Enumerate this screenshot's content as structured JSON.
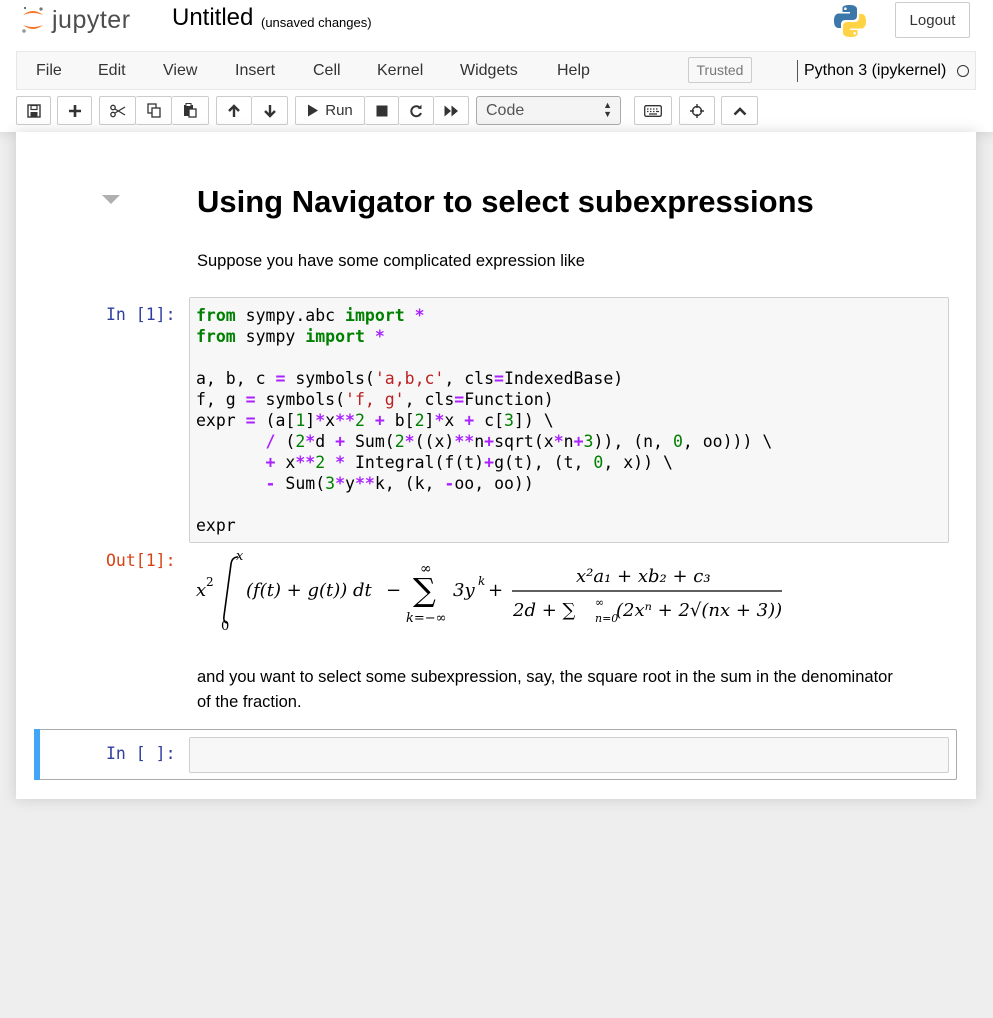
{
  "header": {
    "logo_text": "jupyter",
    "notebook_name": "Untitled",
    "save_status": "(unsaved changes)",
    "logout_label": "Logout"
  },
  "menubar": {
    "items": [
      "File",
      "Edit",
      "View",
      "Insert",
      "Cell",
      "Kernel",
      "Widgets",
      "Help"
    ],
    "trusted_label": "Trusted",
    "kernel_name": "Python 3 (ipykernel)"
  },
  "toolbar": {
    "run_label": "Run",
    "cell_type": "Code",
    "icons": [
      "save-icon",
      "plus-icon",
      "cut-icon",
      "copy-icon",
      "paste-icon",
      "arrow-up-icon",
      "arrow-down-icon",
      "run-icon",
      "stop-icon",
      "restart-icon",
      "fast-forward-icon",
      "keyboard-icon",
      "crosshair-icon",
      "chevron-up-icon"
    ]
  },
  "cells": {
    "heading": "Using Navigator to select subexpressions",
    "para1": "Suppose you have some complicated expression like",
    "in1_prompt": "In [1]:",
    "out1_prompt": "Out[1]:",
    "para2": "and you want to select some subexpression, say, the square root in the sum in the denominator of the fraction.",
    "in2_prompt": "In [ ]:"
  },
  "code_lines": [
    "from sympy.abc import *",
    "from sympy import *",
    "",
    "a, b, c = symbols('a,b,c', cls=IndexedBase)",
    "f, g = symbols('f, g', cls=Function)",
    "expr = (a[1]*x**2 + b[2]*x + c[3]) \\",
    "       / (2*d + Sum(2*((x)**n+sqrt(x*n+3)), (n, 0, oo))) \\",
    "       + x**2 * Integral(f(t)+g(t), (t, 0, x)) \\",
    "       - Sum(3*y**k, (k, -oo, oo))",
    "",
    "expr"
  ],
  "output_math": {
    "integral_upper": "x",
    "integral_lower": "0",
    "integrand": "(f(t) + g(t)) dt",
    "sum_upper": "∞",
    "sum_lower": "k=−∞",
    "sum_term": "3y",
    "sum_exp": "k",
    "numerator": "x²a₁ + xb₂ + c₃",
    "denominator_prefix": "2d + ∑",
    "denominator_sum_upper": "∞",
    "denominator_sum_lower": "n=0",
    "denominator_body": "(2xⁿ + 2√(nx + 3))"
  },
  "colors": {
    "keyword": "#008000",
    "operator": "#aa22ff",
    "string": "#ba2121",
    "in_prompt": "#303f9f",
    "out_prompt": "#d84315",
    "selected_cell_bar": "#42a5f5"
  }
}
